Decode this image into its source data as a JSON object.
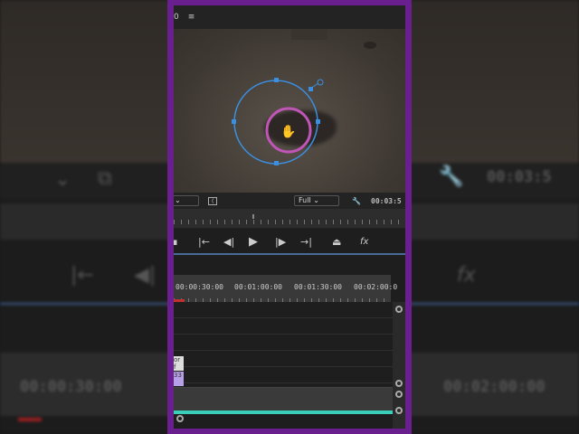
{
  "background": {
    "timecode_top": "00:03:5",
    "timecode_left": "00:00:30:00",
    "timecode_right": "00:02:00:00"
  },
  "top_bar": {
    "frame_label": "0",
    "menu_icon": "hamburger-icon"
  },
  "controls": {
    "zoom_value": "Full",
    "timecode": "00:03:5"
  },
  "transport": {
    "buttons": [
      "mark-in",
      "go-to-in",
      "step-back",
      "play",
      "step-forward",
      "go-to-out",
      "export-frame",
      "fx"
    ],
    "fx_label": "fx"
  },
  "timeline": {
    "ruler_labels": [
      "00:00:30:00",
      "00:01:00:00",
      "00:01:30:00",
      "00:02:00:0"
    ],
    "clip_labels": [
      "or f",
      "33"
    ]
  },
  "colors": {
    "frame": "#6a1f8f",
    "mask": "#3b8fe0",
    "highlight": "#c055b8",
    "audio": "#3ad0b8"
  }
}
